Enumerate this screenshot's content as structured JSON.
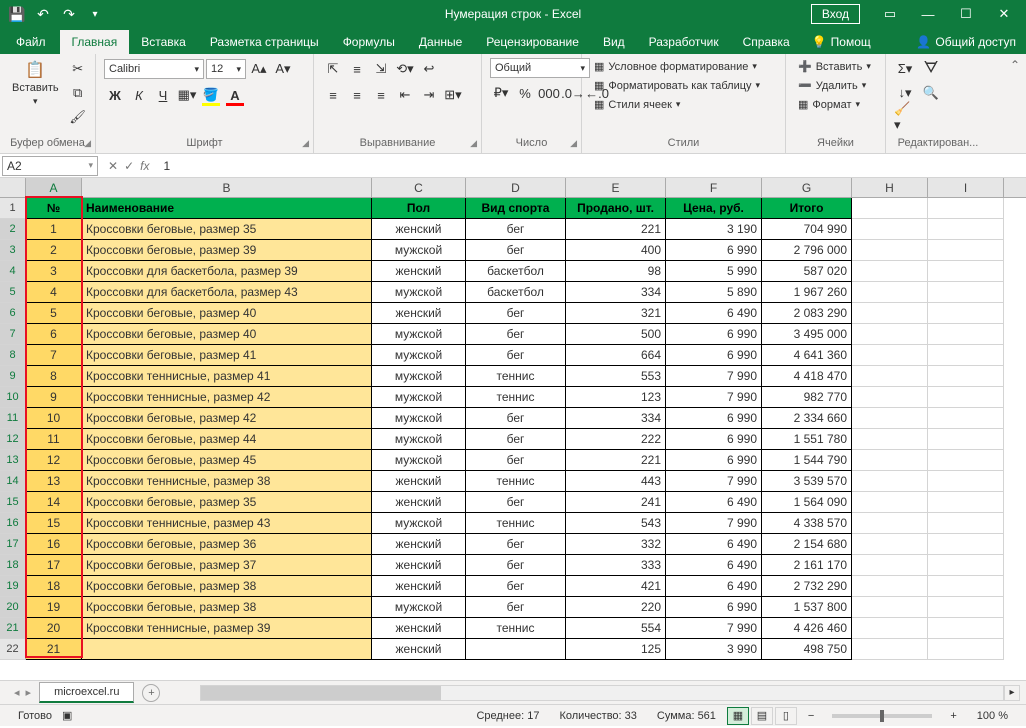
{
  "titlebar": {
    "title": "Нумерация строк  -  Excel",
    "signin": "Вход"
  },
  "tabs": {
    "file": "Файл",
    "home": "Главная",
    "insert": "Вставка",
    "layout": "Разметка страницы",
    "formulas": "Формулы",
    "data": "Данные",
    "review": "Рецензирование",
    "view": "Вид",
    "developer": "Разработчик",
    "help": "Справка",
    "tellme": "Помощ",
    "share": "Общий доступ"
  },
  "ribbon": {
    "clipboard": {
      "label": "Буфер обмена",
      "paste": "Вставить"
    },
    "font": {
      "label": "Шрифт",
      "name": "Calibri",
      "size": "12"
    },
    "alignment": {
      "label": "Выравнивание"
    },
    "number": {
      "label": "Число",
      "format": "Общий"
    },
    "styles": {
      "label": "Стили",
      "cond": "Условное форматирование",
      "table": "Форматировать как таблицу",
      "cell": "Стили ячеек"
    },
    "cells": {
      "label": "Ячейки",
      "insert": "Вставить",
      "delete": "Удалить",
      "format": "Формат"
    },
    "editing": {
      "label": "Редактирован..."
    }
  },
  "formula": {
    "namebox": "A2",
    "value": "1"
  },
  "cols": [
    "A",
    "B",
    "C",
    "D",
    "E",
    "F",
    "G",
    "H",
    "I"
  ],
  "headers": {
    "a": "№",
    "b": "Наименование",
    "c": "Пол",
    "d": "Вид спорта",
    "e": "Продано, шт.",
    "f": "Цена, руб.",
    "g": "Итого"
  },
  "rows": [
    {
      "n": "1",
      "name": "Кроссовки беговые, размер 35",
      "sex": "женский",
      "sport": "бег",
      "sold": "221",
      "price": "3 190",
      "total": "704 990"
    },
    {
      "n": "2",
      "name": "Кроссовки беговые, размер 39",
      "sex": "мужской",
      "sport": "бег",
      "sold": "400",
      "price": "6 990",
      "total": "2 796 000"
    },
    {
      "n": "3",
      "name": "Кроссовки для баскетбола, размер 39",
      "sex": "женский",
      "sport": "баскетбол",
      "sold": "98",
      "price": "5 990",
      "total": "587 020"
    },
    {
      "n": "4",
      "name": "Кроссовки для баскетбола, размер 43",
      "sex": "мужской",
      "sport": "баскетбол",
      "sold": "334",
      "price": "5 890",
      "total": "1 967 260"
    },
    {
      "n": "5",
      "name": "Кроссовки беговые, размер 40",
      "sex": "женский",
      "sport": "бег",
      "sold": "321",
      "price": "6 490",
      "total": "2 083 290"
    },
    {
      "n": "6",
      "name": "Кроссовки беговые, размер 40",
      "sex": "мужской",
      "sport": "бег",
      "sold": "500",
      "price": "6 990",
      "total": "3 495 000"
    },
    {
      "n": "7",
      "name": "Кроссовки беговые, размер 41",
      "sex": "мужской",
      "sport": "бег",
      "sold": "664",
      "price": "6 990",
      "total": "4 641 360"
    },
    {
      "n": "8",
      "name": "Кроссовки теннисные, размер 41",
      "sex": "мужской",
      "sport": "теннис",
      "sold": "553",
      "price": "7 990",
      "total": "4 418 470"
    },
    {
      "n": "9",
      "name": "Кроссовки теннисные, размер 42",
      "sex": "мужской",
      "sport": "теннис",
      "sold": "123",
      "price": "7 990",
      "total": "982 770"
    },
    {
      "n": "10",
      "name": "Кроссовки беговые, размер 42",
      "sex": "мужской",
      "sport": "бег",
      "sold": "334",
      "price": "6 990",
      "total": "2 334 660"
    },
    {
      "n": "11",
      "name": "Кроссовки беговые, размер 44",
      "sex": "мужской",
      "sport": "бег",
      "sold": "222",
      "price": "6 990",
      "total": "1 551 780"
    },
    {
      "n": "12",
      "name": "Кроссовки беговые, размер 45",
      "sex": "мужской",
      "sport": "бег",
      "sold": "221",
      "price": "6 990",
      "total": "1 544 790"
    },
    {
      "n": "13",
      "name": "Кроссовки теннисные, размер 38",
      "sex": "женский",
      "sport": "теннис",
      "sold": "443",
      "price": "7 990",
      "total": "3 539 570"
    },
    {
      "n": "14",
      "name": "Кроссовки беговые, размер 35",
      "sex": "женский",
      "sport": "бег",
      "sold": "241",
      "price": "6 490",
      "total": "1 564 090"
    },
    {
      "n": "15",
      "name": "Кроссовки теннисные, размер 43",
      "sex": "мужской",
      "sport": "теннис",
      "sold": "543",
      "price": "7 990",
      "total": "4 338 570"
    },
    {
      "n": "16",
      "name": "Кроссовки беговые, размер 36",
      "sex": "женский",
      "sport": "бег",
      "sold": "332",
      "price": "6 490",
      "total": "2 154 680"
    },
    {
      "n": "17",
      "name": "Кроссовки беговые, размер 37",
      "sex": "женский",
      "sport": "бег",
      "sold": "333",
      "price": "6 490",
      "total": "2 161 170"
    },
    {
      "n": "18",
      "name": "Кроссовки беговые, размер 38",
      "sex": "женский",
      "sport": "бег",
      "sold": "421",
      "price": "6 490",
      "total": "2 732 290"
    },
    {
      "n": "19",
      "name": "Кроссовки беговые, размер 38",
      "sex": "мужской",
      "sport": "бег",
      "sold": "220",
      "price": "6 990",
      "total": "1 537 800"
    },
    {
      "n": "20",
      "name": "Кроссовки теннисные, размер 39",
      "sex": "женский",
      "sport": "теннис",
      "sold": "554",
      "price": "7 990",
      "total": "4 426 460"
    },
    {
      "n": "21",
      "name": "",
      "sex": "женский",
      "sport": "",
      "sold": "125",
      "price": "3 990",
      "total": "498 750"
    }
  ],
  "sheet": {
    "name": "microexcel.ru"
  },
  "status": {
    "ready": "Готово",
    "avg": "Среднее: 17",
    "count": "Количество: 33",
    "sum": "Сумма: 561",
    "zoom": "100 %"
  }
}
